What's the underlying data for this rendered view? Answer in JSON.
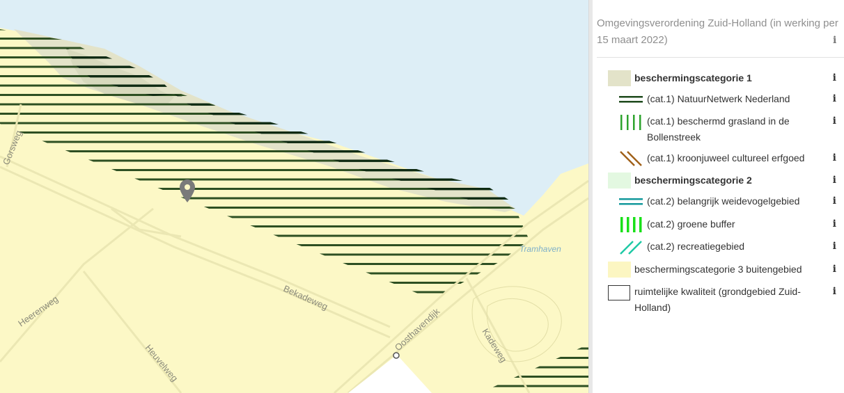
{
  "map": {
    "labels": {
      "gorsweg": "Gorsweg",
      "heerenweg": "Heerenweg",
      "bekadeweg": "Bekadeweg",
      "heuvelweg": "Heuvelweg",
      "oosthavendijk": "Oosthavendijk",
      "kadeweg": "Kadeweg",
      "tramhaven": "Tramhaven"
    },
    "colors": {
      "water": "#ddeef6",
      "land": "#fcf8c6",
      "cat1_fill": "#e3e3c9",
      "nnn_stripe": "#1e4a1c",
      "nnn_stripe_dark": "#0f2a12"
    }
  },
  "legend": {
    "title": "Omgevingsverordening Zuid-Holland (in werking per 15 maart 2022)",
    "info_glyph": "i",
    "items": [
      {
        "label": "beschermingscategorie 1",
        "bold": true,
        "symbol": "fill-beige",
        "color": "#e3e3c9"
      },
      {
        "label": "(cat.1) NatuurNetwerk Nederland",
        "bold": false,
        "symbol": "hlines",
        "color": "#1e4a1c"
      },
      {
        "label": "(cat.1) beschermd grasland in de Bollenstreek",
        "bold": false,
        "symbol": "vlines",
        "color": "#2ea32e"
      },
      {
        "label": "(cat.1) kroonjuweel cultureel erfgoed",
        "bold": false,
        "symbol": "dlines-down",
        "color": "#a0611a"
      },
      {
        "label": "beschermingscategorie 2",
        "bold": true,
        "symbol": "fill-green",
        "color": "#e3f8e1"
      },
      {
        "label": "(cat.2) belangrijk weidevogelgebied",
        "bold": false,
        "symbol": "hlines",
        "color": "#14999c"
      },
      {
        "label": "(cat.2) groene buffer",
        "bold": false,
        "symbol": "vlines",
        "color": "#19e019"
      },
      {
        "label": "(cat.2) recreatiegebied",
        "bold": false,
        "symbol": "dlines-up",
        "color": "#1ec9a5"
      },
      {
        "label": "beschermingscategorie 3 buitengebied",
        "bold": false,
        "symbol": "fill-yellow",
        "color": "#fcf6c2"
      },
      {
        "label": "ruimtelijke kwaliteit (grondgebied Zuid-Holland)",
        "bold": false,
        "symbol": "outline",
        "color": "#333333"
      }
    ]
  }
}
